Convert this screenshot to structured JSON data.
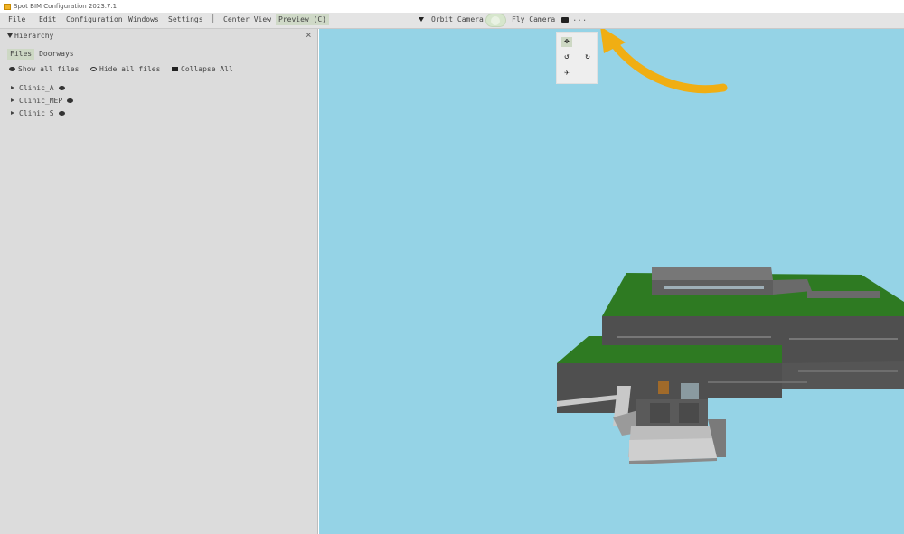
{
  "window": {
    "title": "Spot BIM Configuration 2023.7.1"
  },
  "menubar": {
    "items": [
      "File",
      "Edit",
      "Configuration",
      "Windows",
      "Settings"
    ],
    "separator": "|",
    "center_view": "Center View",
    "preview": "Preview (C)",
    "orbit_camera": "Orbit Camera",
    "fly_camera": "Fly Camera",
    "more": "..."
  },
  "hierarchy": {
    "title": "Hierarchy",
    "close": "×",
    "tabs": [
      {
        "label": "Files",
        "active": true
      },
      {
        "label": "Doorways",
        "active": false
      }
    ],
    "actions": {
      "show_all": "Show all files",
      "hide_all": "Hide all files",
      "collapse_all": "Collapse All"
    },
    "tree": [
      {
        "label": "Clinic_A"
      },
      {
        "label": "Clinic_MEP"
      },
      {
        "label": "Clinic_S"
      }
    ]
  },
  "camera_menu": {
    "options": [
      {
        "icon": "orbit-camera-icon",
        "glyph": "✥",
        "selected": true
      },
      {
        "icon": "rotate-left-icon",
        "glyph": "↺",
        "selected": false
      },
      {
        "icon": "rotate-right-icon",
        "glyph": "↻",
        "selected": false
      },
      {
        "icon": "fly-camera-icon",
        "glyph": "✈",
        "selected": false
      }
    ]
  },
  "colors": {
    "sky": "#95d3e6",
    "roof_green": "#2e7a22",
    "wall_dark": "#4f4f4f",
    "wall_gray": "#7a7a7a",
    "annotation_arrow": "#f0ae13"
  }
}
